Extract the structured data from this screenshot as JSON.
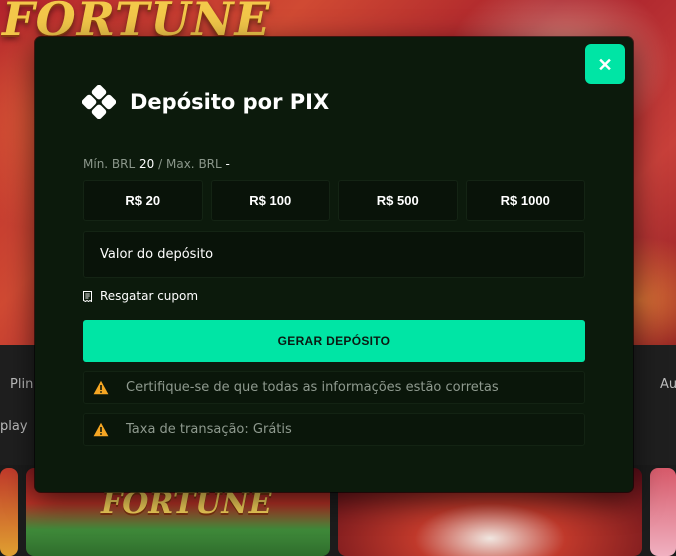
{
  "background": {
    "hero_title": "FORTUNE",
    "strip_left_top": "Plin",
    "strip_left_bottom": "play",
    "strip_right": "Au",
    "card_title": "FORTUNE"
  },
  "modal": {
    "close_label": "✕",
    "title": "Depósito por PIX",
    "limits": {
      "min_label": "Mín. BRL",
      "min_value": "20",
      "separator": "/",
      "max_label": "Max. BRL",
      "max_value": "-"
    },
    "amount_options": [
      "R$ 20",
      "R$ 100",
      "R$ 500",
      "R$ 1000"
    ],
    "deposit_input": {
      "placeholder": "Valor do depósito"
    },
    "coupon_label": "Resgatar cupom",
    "generate_button": "GERAR DEPÓSITO",
    "notices": [
      "Certifique-se de que todas as informações estão corretas",
      "Taxa de transação: Grátis"
    ]
  },
  "colors": {
    "accent": "#00e5a5",
    "modal_bg": "#0c1a0c",
    "warning": "#f5a623"
  },
  "icons": {
    "pix": "pix-logo-icon",
    "close": "close-icon",
    "coupon": "receipt-icon",
    "warning": "warning-triangle-icon"
  }
}
